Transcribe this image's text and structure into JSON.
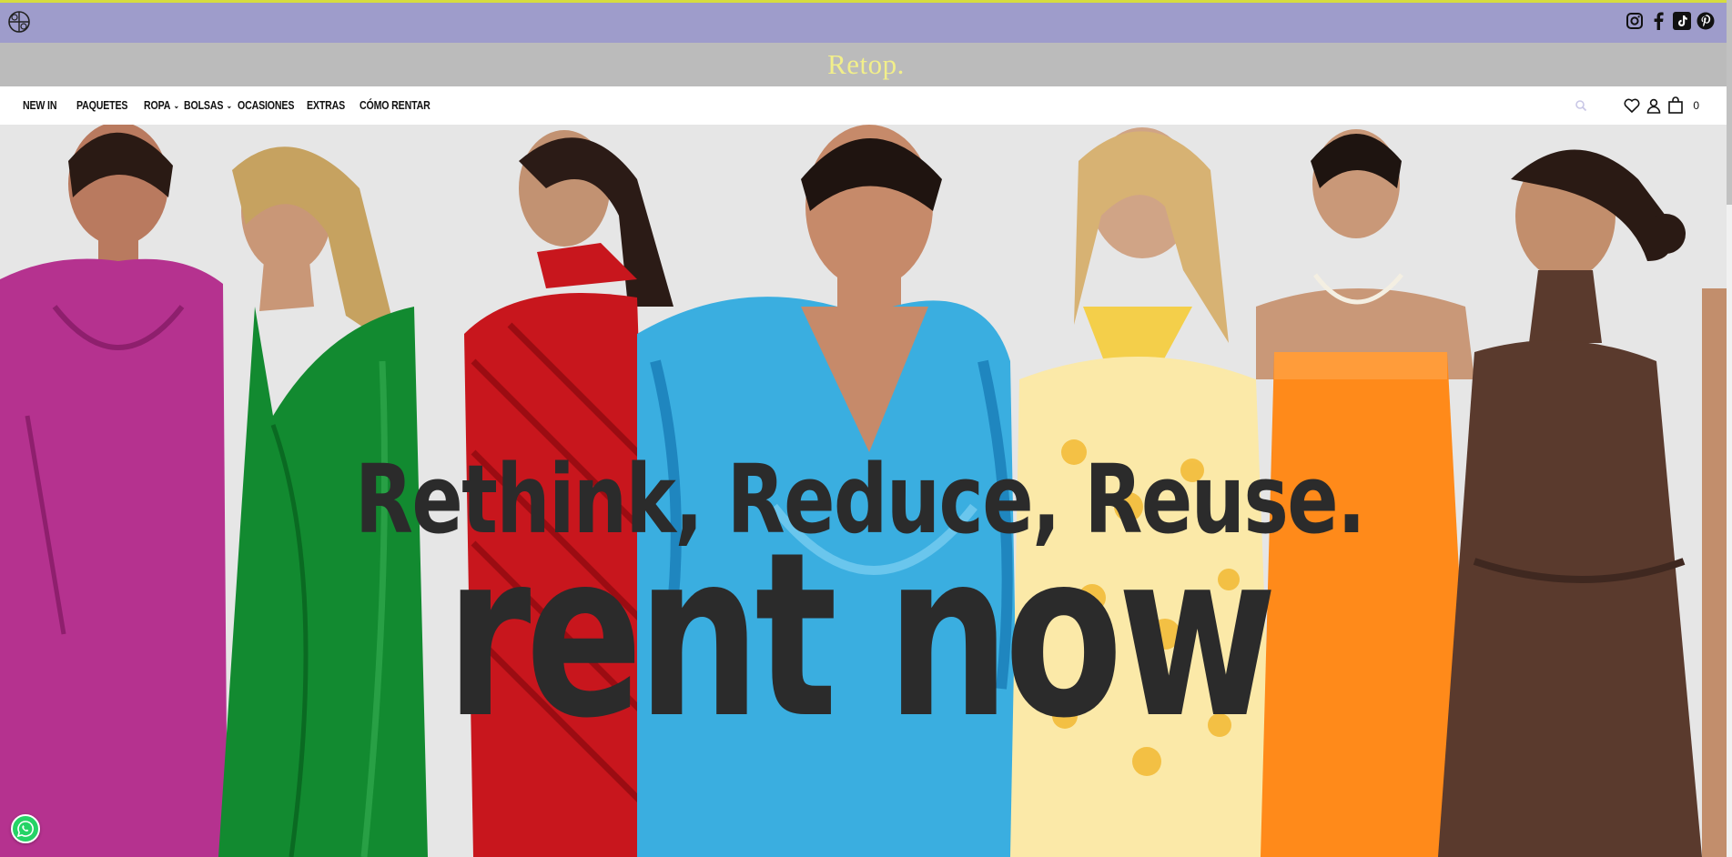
{
  "brand": {
    "name": "Retop.",
    "color": "#f2ef8a"
  },
  "colors": {
    "topbar": "#9e9ccb",
    "topbar_border": "#d6dc3f",
    "brandbar": "#bbbbbb",
    "hero_bg": "#e6e6e6",
    "headline": "#2b2b2b"
  },
  "topbar": {
    "logo_icon": "retop-monogram-icon",
    "socials": [
      "instagram-icon",
      "facebook-icon",
      "tiktok-icon",
      "pinterest-icon"
    ]
  },
  "nav": {
    "items": [
      {
        "label": "NEW IN",
        "dropdown": false
      },
      {
        "label": "PAQUETES",
        "dropdown": false
      },
      {
        "label": "ROPA",
        "dropdown": true
      },
      {
        "label": "BOLSAS",
        "dropdown": true
      },
      {
        "label": "OCASIONES",
        "dropdown": false
      },
      {
        "label": "EXTRAS",
        "dropdown": false
      },
      {
        "label": "CÓMO RENTAR",
        "dropdown": false
      }
    ],
    "icons": [
      "search-icon",
      "heart-icon",
      "user-icon",
      "bag-icon"
    ],
    "cart_count": "0"
  },
  "hero": {
    "headline_1": "Rethink, Reduce, Reuse.",
    "headline_2": "rent now",
    "dress_colors": [
      "#b5328f",
      "#128a30",
      "#c8161d",
      "#3aaee0",
      "#f4cf4a",
      "#ff8a1a",
      "#5a3a2d"
    ]
  },
  "floating": {
    "whatsapp_icon": "whatsapp-icon"
  }
}
